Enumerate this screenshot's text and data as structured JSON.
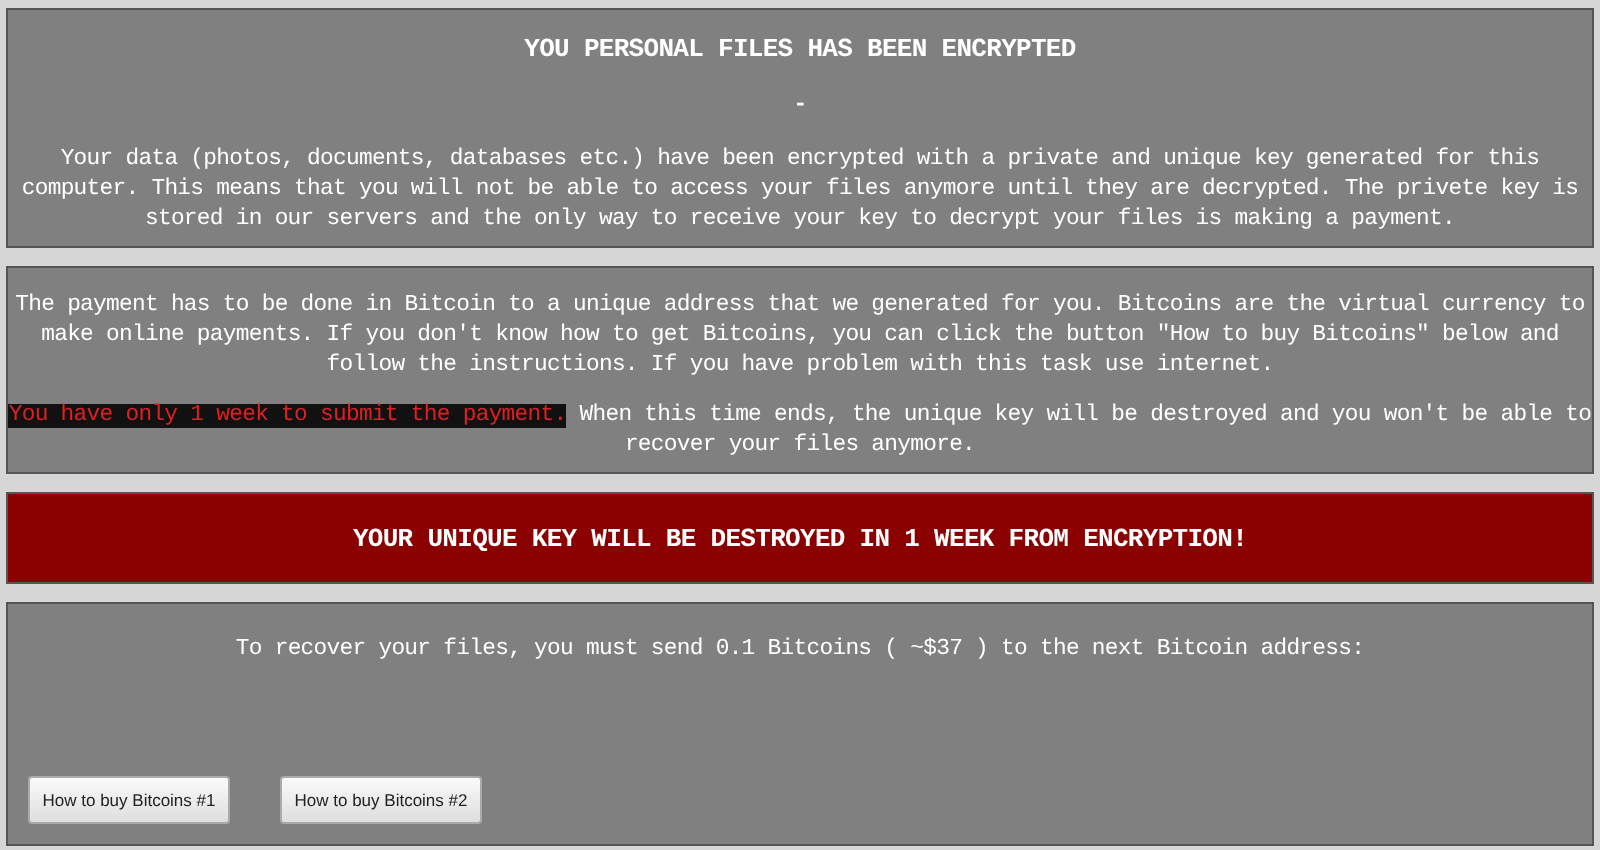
{
  "header": {
    "title": "YOU PERSONAL FILES HAS BEEN ENCRYPTED",
    "separator": "-",
    "message": "Your data (photos, documents, databases etc.) have been encrypted with a private and unique key generated for this computer. This means that you will not be able to access your files anymore until they are decrypted. The privete key is stored in our servers and the only way to receive your key to decrypt your files is making a payment."
  },
  "payment": {
    "message": "The payment has to be done in Bitcoin to a unique address that we generated for you. Bitcoins are the virtual currency to make online payments. If you don't know how to get Bitcoins, you can click the button \"How to buy Bitcoins\" below and follow the instructions. If you have problem with this task use internet.",
    "deadline_highlight": "You have only 1 week to submit the payment.",
    "deadline_text": "When this time ends, the unique key will be destroyed and you won't be able to recover your files anymore."
  },
  "banner": {
    "text": "YOUR UNIQUE KEY WILL BE DESTROYED IN 1 WEEK FROM ENCRYPTION!"
  },
  "recovery": {
    "instruction": "To recover your files, you must send 0.1 Bitcoins ( ~$37 ) to the next Bitcoin address:",
    "buttons": [
      "How to buy Bitcoins #1",
      "How to buy Bitcoins #2"
    ]
  }
}
